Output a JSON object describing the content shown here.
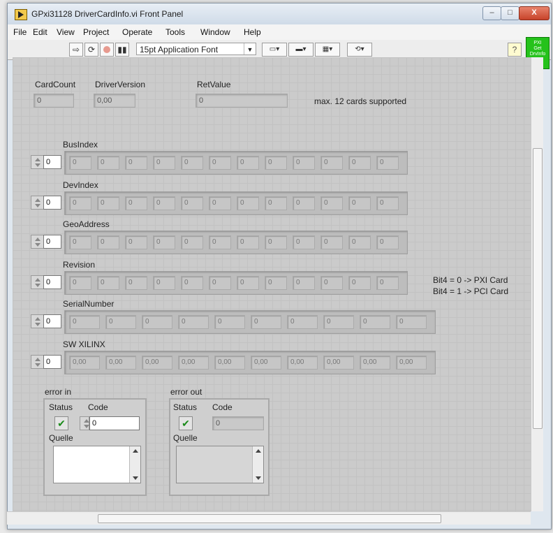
{
  "window": {
    "title": "GPxi31128 DriverCardInfo.vi Front Panel",
    "minimize": "–",
    "maximize": "□",
    "close": "X"
  },
  "menu": [
    "File",
    "Edit",
    "View",
    "Project",
    "Operate",
    "Tools",
    "Window",
    "Help"
  ],
  "toolbar": {
    "run_icon": "run-arrow-icon",
    "continuous_icon": "continuous-run-icon",
    "abort_icon": "abort-icon",
    "pause_icon": "pause-icon",
    "font": "15pt Application Font",
    "help": "?"
  },
  "connector": {
    "line1": "PXI",
    "line2": "Get",
    "line3": "DrvInfo"
  },
  "top_indicators": {
    "card_count_label": "CardCount",
    "card_count_value": "0",
    "driver_version_label": "DriverVersion",
    "driver_version_value": "0,00",
    "ret_value_label": "RetValue",
    "ret_value_value": "0",
    "note": "max. 12 cards supported"
  },
  "arrays": [
    {
      "label": "BusIndex",
      "index": "0",
      "cells": [
        "0",
        "0",
        "0",
        "0",
        "0",
        "0",
        "0",
        "0",
        "0",
        "0",
        "0",
        "0"
      ]
    },
    {
      "label": "DevIndex",
      "index": "0",
      "cells": [
        "0",
        "0",
        "0",
        "0",
        "0",
        "0",
        "0",
        "0",
        "0",
        "0",
        "0",
        "0"
      ]
    },
    {
      "label": "GeoAddress",
      "index": "0",
      "cells": [
        "0",
        "0",
        "0",
        "0",
        "0",
        "0",
        "0",
        "0",
        "0",
        "0",
        "0",
        "0"
      ]
    },
    {
      "label": "Revision",
      "index": "0",
      "cells": [
        "0",
        "0",
        "0",
        "0",
        "0",
        "0",
        "0",
        "0",
        "0",
        "0",
        "0",
        "0"
      ]
    },
    {
      "label": "SerialNumber",
      "index": "0",
      "cells": [
        "0",
        "0",
        "0",
        "0",
        "0",
        "0",
        "0",
        "0",
        "0",
        "0"
      ]
    },
    {
      "label": "SW XILINX",
      "index": "0",
      "cells": [
        "0,00",
        "0,00",
        "0,00",
        "0,00",
        "0,00",
        "0,00",
        "0,00",
        "0,00",
        "0,00",
        "0,00"
      ]
    }
  ],
  "revision_note": {
    "line1": "Bit4 = 0 -> PXI Card",
    "line2": "Bit4 = 1 -> PCI Card"
  },
  "error_in": {
    "title": "error in",
    "status_label": "Status",
    "code_label": "Code",
    "code_value": "0",
    "source_label": "Quelle",
    "status_mark": "✔"
  },
  "error_out": {
    "title": "error out",
    "status_label": "Status",
    "code_label": "Code",
    "code_value": "0",
    "source_label": "Quelle",
    "status_mark": "✔"
  },
  "colors": {
    "panel": "#cbcbcb",
    "connector": "#25c21b",
    "check": "#1a8b1a"
  }
}
